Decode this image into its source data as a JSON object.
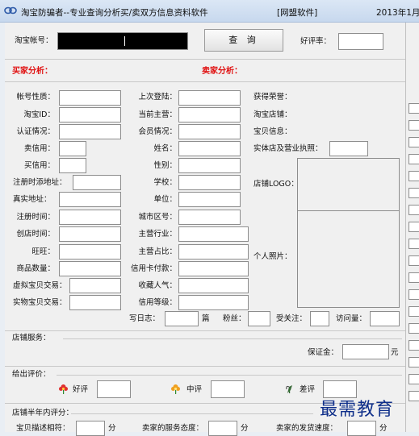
{
  "window": {
    "title": "淘宝防骗者--专业查询分析买/卖双方信息资料软件",
    "vendor": "[网盟软件]",
    "date": "2013年1月"
  },
  "search": {
    "account_label": "淘宝帐号：",
    "button": "查 询",
    "rating_label": "好评率："
  },
  "sections": {
    "buyer": "买家分析：",
    "seller": "卖家分析：",
    "shop_service": "店铺服务：",
    "given_ratings": "给出评价：",
    "half_year": "店铺半年内评分："
  },
  "col1": [
    "帐号性质：",
    "淘宝ID：",
    "认证情况：",
    "卖信用：",
    "买信用：",
    "注册时添地址：",
    "真实地址：",
    "注册时间：",
    "创店时间：",
    "旺旺：",
    "商品数量：",
    "虚拟宝贝交易：",
    "实物宝贝交易："
  ],
  "col2": [
    "上次登陆：",
    "当前主营：",
    "会员情况：",
    "姓名：",
    "性别：",
    "学校：",
    "单位：",
    "城市区号：",
    "主营行业：",
    "主营占比：",
    "信用卡付款：",
    "收藏人气：",
    "信用等级："
  ],
  "col3": {
    "honor": "获得荣誉：",
    "shop": "淘宝店铺：",
    "baby_info": "宝贝信息：",
    "license": "实体店及营业执照：",
    "logo": "店铺LOGO：",
    "photo": "个人照片："
  },
  "stats": {
    "blog": "写日志：",
    "blog_unit": "篇",
    "fans": "粉丝：",
    "followed": "受关注：",
    "visits": "访问量："
  },
  "shop": {
    "deposit": "保证金：",
    "deposit_unit": "元"
  },
  "ratings": {
    "good": "好评",
    "mid": "中评",
    "bad": "差评"
  },
  "half_year": {
    "desc": "宝贝描述相符：",
    "service": "卖家的服务态度：",
    "ship": "卖家的发货速度：",
    "unit": "分"
  },
  "watermark": "最需教育",
  "colors": {
    "red": "#e01010",
    "window_bg": "#f0f0f0"
  }
}
